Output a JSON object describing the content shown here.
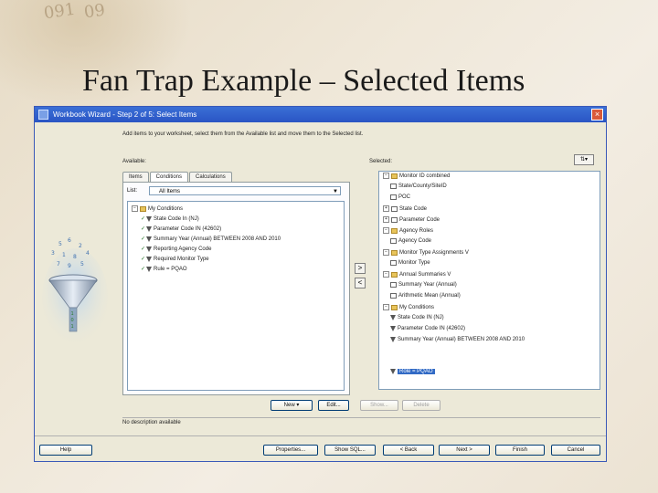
{
  "slide": {
    "title": "Fan Trap Example – Selected Items",
    "deco_numbers": [
      "091",
      "09"
    ]
  },
  "window": {
    "title": "Workbook Wizard - Step 2 of 5: Select Items",
    "close_label": "×"
  },
  "instructions": "Add items to your worksheet, select them from the Available list and move them to the Selected list.",
  "available": {
    "label": "Available:",
    "tabs": [
      "Items",
      "Conditions",
      "Calculations"
    ],
    "list_label": "List:",
    "list_value": "All Items",
    "tree": [
      {
        "label": "My Conditions",
        "type": "folder",
        "level": 0
      },
      {
        "label": "State Code In (NJ)",
        "type": "filter",
        "level": 1
      },
      {
        "label": "Parameter Code IN (42602)",
        "type": "filter",
        "level": 1
      },
      {
        "label": "Summary Year (Annual) BETWEEN 2008 AND 2010",
        "type": "filter",
        "level": 1
      },
      {
        "label": "Reporting Agency Code",
        "type": "filter",
        "level": 1
      },
      {
        "label": "Required Monitor Type",
        "type": "filter",
        "level": 1
      },
      {
        "label": "Rule = PQAO",
        "type": "filter",
        "level": 1
      }
    ]
  },
  "selected": {
    "label": "Selected:",
    "tree": [
      {
        "label": "Monitor ID combined",
        "type": "folder",
        "level": 0
      },
      {
        "label": "State/County/SiteID",
        "type": "doc",
        "level": 1
      },
      {
        "label": "POC",
        "type": "doc",
        "level": 1
      },
      {
        "label": "State Code",
        "type": "doc",
        "level": 1
      },
      {
        "label": "Parameter Code",
        "type": "doc",
        "level": 1
      },
      {
        "label": "Agency Roles",
        "type": "folder",
        "level": 0
      },
      {
        "label": "Agency Code",
        "type": "doc",
        "level": 1
      },
      {
        "label": "Monitor Type Assignments V",
        "type": "folder",
        "level": 0
      },
      {
        "label": "Monitor Type",
        "type": "doc",
        "level": 1
      },
      {
        "label": "Annual Summaries V",
        "type": "folder",
        "level": 0
      },
      {
        "label": "Summary Year (Annual)",
        "type": "doc",
        "level": 1
      },
      {
        "label": "Arithmetic Mean (Annual)",
        "type": "doc",
        "level": 1
      },
      {
        "label": "My Conditions",
        "type": "folder",
        "level": 0
      },
      {
        "label": "State Code IN (NJ)",
        "type": "filter",
        "level": 1
      },
      {
        "label": "Parameter Code IN (42602)",
        "type": "filter",
        "level": 1
      },
      {
        "label": "Summary Year (Annual) BETWEEN 2008 AND 2010",
        "type": "filter",
        "level": 1
      },
      {
        "label": "Role = PQAO",
        "type": "filter",
        "level": 1,
        "selected": true
      }
    ]
  },
  "move_buttons": {
    "add": ">",
    "remove": "<"
  },
  "left_actions": {
    "new": "New ▾",
    "edit": "Edit...",
    "show": "Show..."
  },
  "right_actions": {
    "delete": "Delete"
  },
  "status": "No description available",
  "footer": {
    "help": "Help",
    "properties": "Properties...",
    "show_sql": "Show SQL...",
    "back": "< Back",
    "next": "Next >",
    "finish": "Finish",
    "cancel": "Cancel"
  },
  "colors": {
    "titlebar": "#2a55c4",
    "selection": "#316ac5",
    "folder": "#e8c45a"
  }
}
